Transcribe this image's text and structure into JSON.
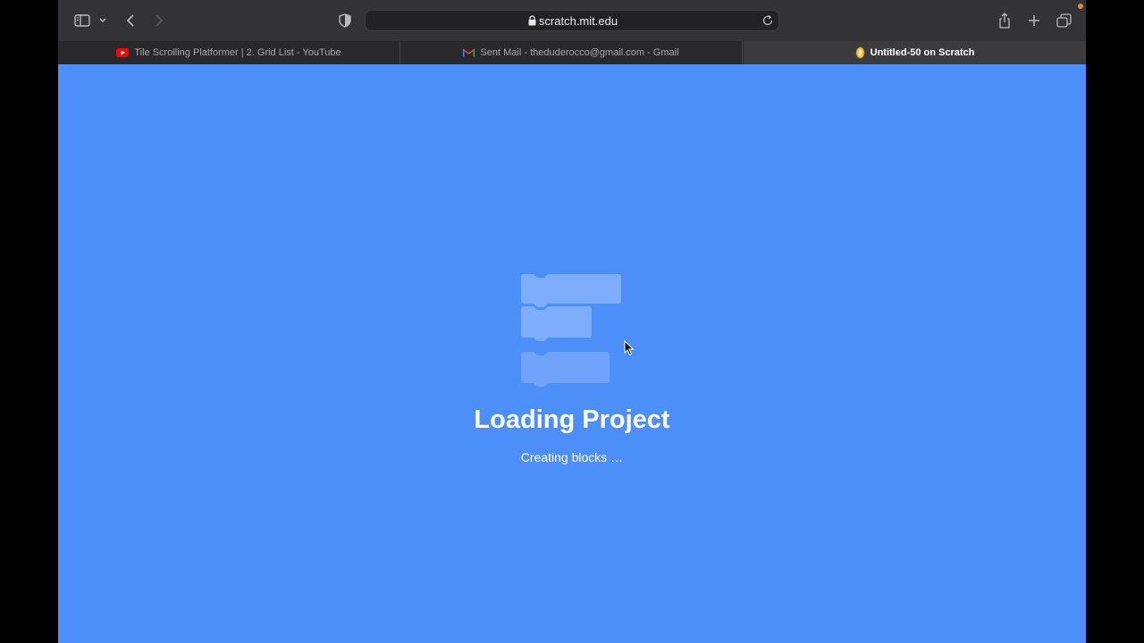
{
  "browser": {
    "address": {
      "url": "scratch.mit.edu"
    },
    "tabs": [
      {
        "title": "Tile Scrolling Platformer | 2. Grid List - YouTube",
        "favicon": "youtube-icon"
      },
      {
        "title": "Sent Mail - theduderocco@gmail.com - Gmail",
        "favicon": "gmail-icon"
      },
      {
        "title": "Untitled-50 on Scratch",
        "favicon": "scratch-icon",
        "active": true
      }
    ]
  },
  "page": {
    "title": "Loading Project",
    "status": "Creating blocks …",
    "background_color": "#4c8ff9"
  }
}
